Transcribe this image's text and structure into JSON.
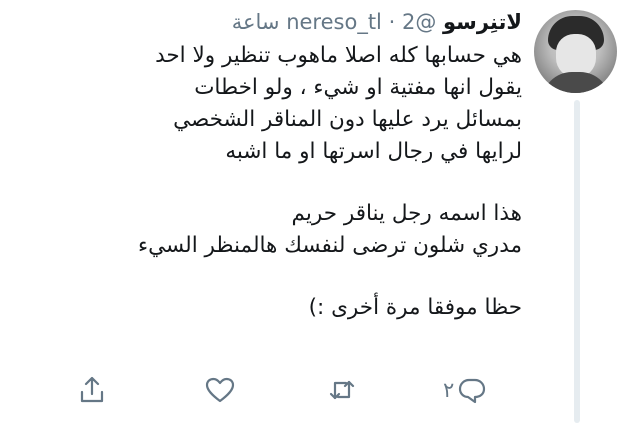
{
  "tweet": {
    "author_name": "لاتنِرسو",
    "handle": "@nereso_tl",
    "separator": "·",
    "time": "2 ساعة",
    "lines": [
      "هي حسابها كله اصلا ماهوب تنظير ولا احد",
      "يقول انها مفتية او شيء ، ولو اخطات",
      "بمسائل يرد عليها دون المناقر الشخصي",
      "لرايها في رجال اسرتها او ما اشبه",
      "هذا اسمه رجل يناقر حريم",
      "مدري شلون ترضى لنفسك هالمنظر السيء",
      "حظا موفقا مرة أخرى :)"
    ],
    "reply_count": "٢"
  },
  "icons": {
    "share": "share-icon",
    "like": "heart-icon",
    "retweet": "retweet-icon",
    "reply": "reply-icon"
  },
  "colors": {
    "text": "#14171a",
    "secondary": "#657786",
    "thread_line": "#e6ecf0"
  }
}
